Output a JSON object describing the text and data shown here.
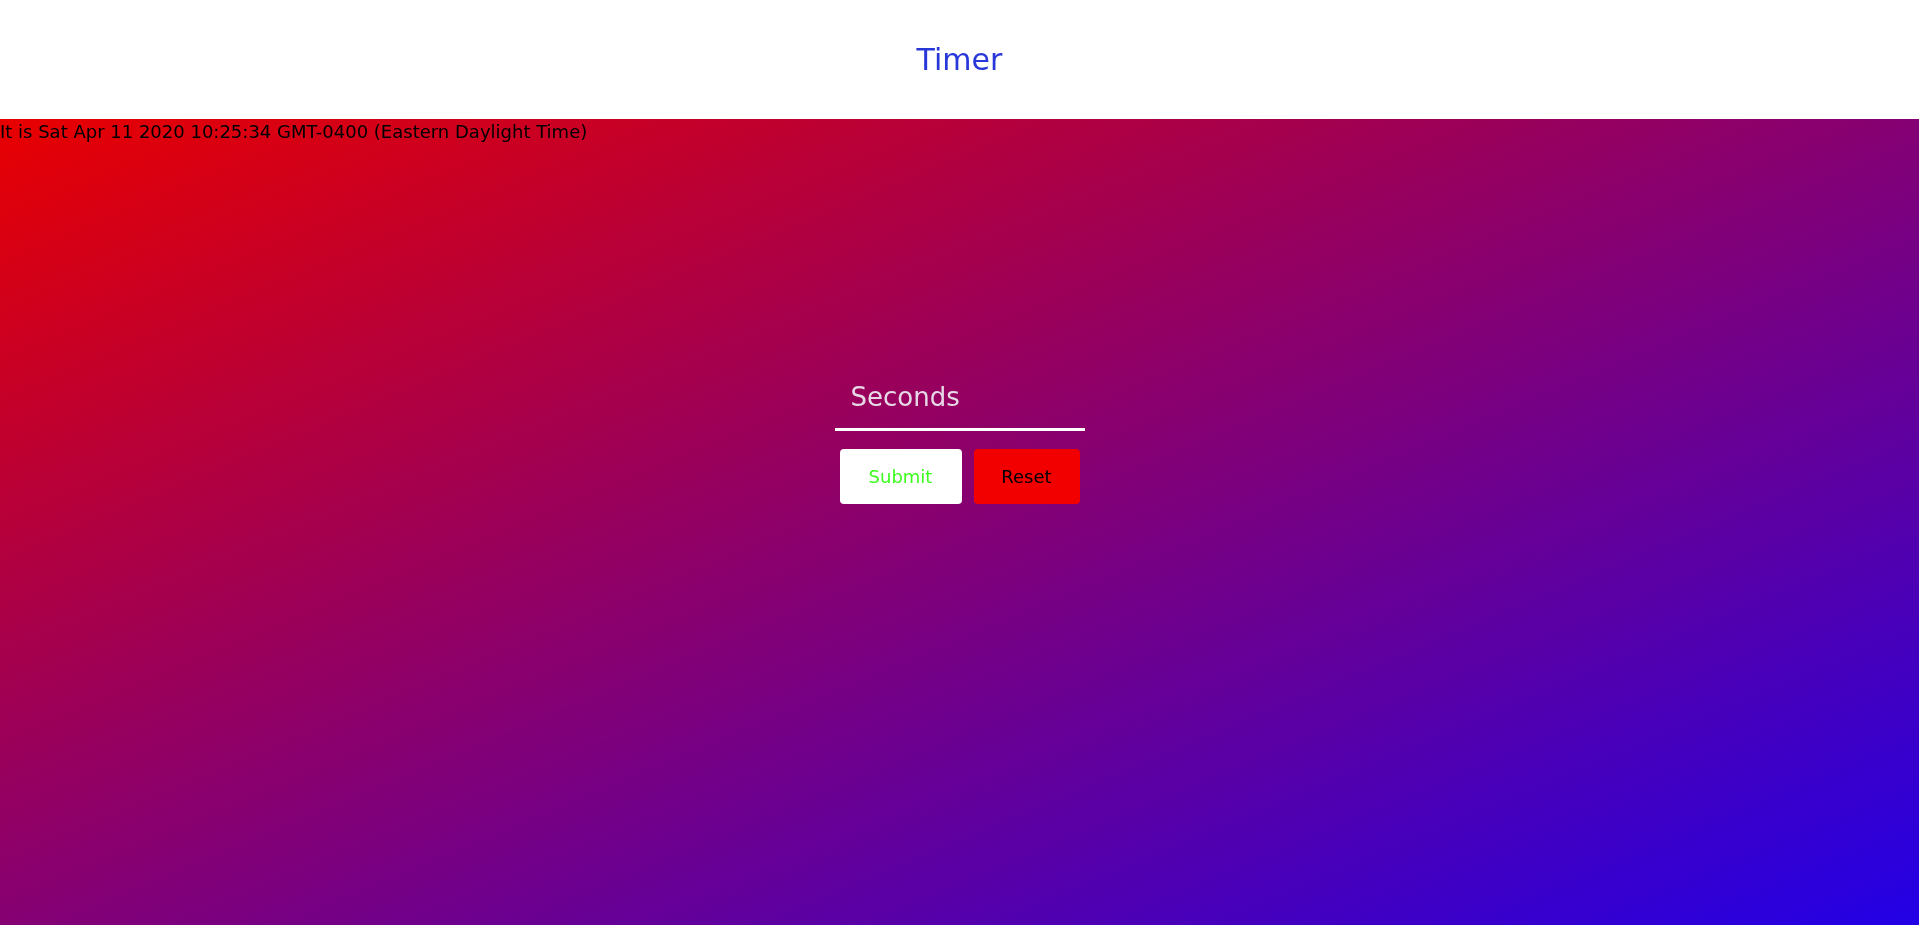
{
  "header": {
    "title": "Timer"
  },
  "clock": {
    "text": "It is Sat Apr 11 2020 10:25:34 GMT-0400 (Eastern Daylight Time)"
  },
  "form": {
    "input": {
      "placeholder": "Seconds"
    },
    "buttons": [
      {
        "label": "Submit",
        "kind": "submit"
      },
      {
        "label": "Reset",
        "kind": "reset"
      }
    ]
  }
}
